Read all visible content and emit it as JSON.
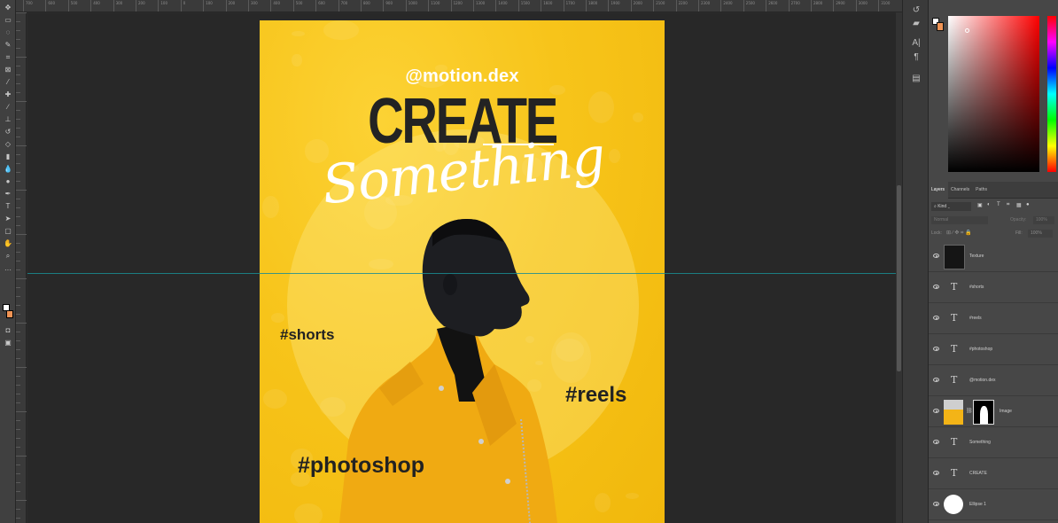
{
  "poster": {
    "handle": "@motion.dex",
    "headline": "CREATE",
    "script": "Something",
    "tags": [
      "#shorts",
      "#reels",
      "#photoshop"
    ]
  },
  "panel": {
    "tabs": [
      "Layers",
      "Channels",
      "Paths"
    ],
    "filter_kind": "Kind",
    "blend_mode": "Normal",
    "opacity_label": "Opacity:",
    "opacity_value": "100%",
    "lock_label": "Lock:",
    "fill_label": "Fill:",
    "fill_value": "100%",
    "layers": [
      {
        "name": "Texture",
        "kind": "image"
      },
      {
        "name": "#shorts",
        "kind": "text"
      },
      {
        "name": "#reels",
        "kind": "text"
      },
      {
        "name": "#photoshop",
        "kind": "text"
      },
      {
        "name": "@motion.dex",
        "kind": "text"
      },
      {
        "name": "Image",
        "kind": "masked-image"
      },
      {
        "name": "Something",
        "kind": "text"
      },
      {
        "name": "CREATE",
        "kind": "text"
      },
      {
        "name": "Ellipse 1",
        "kind": "shape"
      }
    ]
  },
  "colors": {
    "poster_yellow": "#f7c41a",
    "foreground_swatch": "#ffffff",
    "background_swatch": "#f09455",
    "guide": "#1a8c92"
  },
  "ruler_labels": [
    "700",
    "600",
    "500",
    "400",
    "300",
    "200",
    "100",
    "0",
    "100",
    "200",
    "300",
    "400",
    "500",
    "600",
    "700",
    "800",
    "900",
    "1000",
    "1100",
    "1200",
    "1300",
    "1400",
    "1500",
    "1600",
    "1700",
    "1800",
    "1900",
    "2000",
    "2100",
    "2200",
    "2300",
    "2400",
    "2500",
    "2600",
    "2700",
    "2800",
    "2900",
    "3000",
    "3100"
  ]
}
